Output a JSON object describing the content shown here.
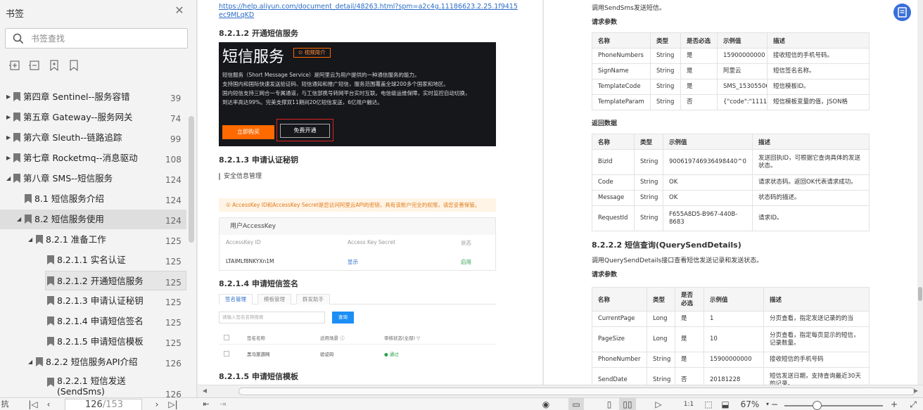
{
  "sidebar": {
    "title": "书签",
    "search_placeholder": "书签查找",
    "bookmarks": [
      {
        "label": "第四章 Sentinel--服务容错",
        "page": "39"
      },
      {
        "label": "第五章 Gateway--服务网关",
        "page": "74"
      },
      {
        "label": "第六章 Sleuth--链路追踪",
        "page": "99"
      },
      {
        "label": "第七章 Rocketmq--消息驱动",
        "page": "108"
      },
      {
        "label": "第八章 SMS--短信服务",
        "page": "124"
      },
      {
        "label": "8.1 短信服务介绍",
        "page": "124"
      },
      {
        "label": "8.2 短信服务使用",
        "page": "124"
      },
      {
        "label": "8.2.1 准备工作",
        "page": "125"
      },
      {
        "label": "8.2.1.1 实名认证",
        "page": "125"
      },
      {
        "label": "8.2.1.2 开通短信服务",
        "page": "125"
      },
      {
        "label": "8.2.1.3 申请认证秘钥",
        "page": "125"
      },
      {
        "label": "8.2.1.4 申请短信签名",
        "page": "125"
      },
      {
        "label": "8.2.1.5 申请短信模板",
        "page": "125"
      },
      {
        "label": "8.2.2 短信服务API介绍",
        "page": "126"
      },
      {
        "label": "8.2.2.1 短信发送(SendSms)",
        "page": "126"
      }
    ]
  },
  "left_page": {
    "link": "https://help.aliyun.com/document_detail/48263.html?spm=a2c4g.11186623.2.25.1f9415ec9MLqKD",
    "h_open": "8.2.1.2 开通短信服务",
    "banner": {
      "title": "短信服务",
      "badge": "⊙ 视频简介",
      "desc": [
        "短信服务（Short Message Service）是阿里云为用户提供的一种通信服务的能力。",
        "支持国内和国际快速发送验证码、短信通知和推广短信，服务范围覆盖全球200多个国家和地区。",
        "国内短信支持三网合一专属通道，与工信部携号转网平台实时互联。电信级运维保障，实时监控自动切换，",
        "到达率高达99%。完美支撑双11期间20亿短信发送，6亿用户触达。"
      ],
      "buy": "立即购买",
      "free": "免费开通"
    },
    "h_key": "8.2.1.3 申请认证秘钥",
    "note": "安全信息管理",
    "warning": "① AccessKey ID和AccessKey Secret是您访问阿里云API的密钥，具有该账户完全的权限，请您妥善保管。",
    "ak": {
      "title": "用户AccessKey",
      "h_id": "AccessKey ID",
      "h_secret": "Access Key Secret",
      "h_status": "状态",
      "id": "LTAIMLf8NKYXn1M",
      "secret": "显示",
      "status": "启用"
    },
    "h_sign": "8.2.1.4 申请短信签名",
    "sign_tabs": [
      "签名管理",
      "模板管理",
      "群发助手"
    ],
    "sign_input": "请输入签名名称搜索",
    "sign_btn": "查询",
    "sign_head": [
      "签名名称",
      "适用场景 ⓘ",
      "审核状态(全部) ▽"
    ],
    "sign_row": [
      "黑马旅游网",
      "验证码",
      "● 通过"
    ],
    "h_tpl": "8.2.1.5 申请短信模板"
  },
  "right_page": {
    "intro": "调用SendSms发送短信。",
    "req_label": "请求参数",
    "req_head": [
      "名称",
      "类型",
      "是否必选",
      "示例值",
      "描述"
    ],
    "req_rows": [
      [
        "PhoneNumbers",
        "String",
        "是",
        "15900000000",
        "接收短信的手机号码。"
      ],
      [
        "SignName",
        "String",
        "是",
        "阿里云",
        "短信签名名称。"
      ],
      [
        "TemplateCode",
        "String",
        "是",
        "SMS_153055065",
        "短信模板ID。"
      ],
      [
        "TemplateParam",
        "String",
        "否",
        "{\"code\":\"1111\"}",
        "短信模板变量的值，JSON格"
      ]
    ],
    "resp_label": "返回数据",
    "resp_head": [
      "名称",
      "类型",
      "示例值",
      "描述"
    ],
    "resp_rows": [
      [
        "BizId",
        "String",
        "900619746936498440^0",
        "发送回执ID，可根据它查询具体的发送状态。"
      ],
      [
        "Code",
        "String",
        "OK",
        "请求状态码。返回OK代表请求成功。"
      ],
      [
        "Message",
        "String",
        "OK",
        "状态码的描述。"
      ],
      [
        "RequestId",
        "String",
        "F655A8D5-B967-440B-8683",
        "请求ID。"
      ]
    ],
    "h_query": "8.2.2.2 短信查询(QuerySendDetails)",
    "query_intro": "调用QuerySendDetails接口查看短信发送记录和发送状态。",
    "req2_label": "请求参数",
    "req2_head": [
      "名称",
      "类型",
      "是否必选",
      "示例值",
      "描述"
    ],
    "req2_rows": [
      [
        "CurrentPage",
        "Long",
        "是",
        "1",
        "分页查看，指定发送记录的的当"
      ],
      [
        "PageSize",
        "Long",
        "是",
        "10",
        "分页查看，指定每页显示的短信，记录数量。"
      ],
      [
        "PhoneNumber",
        "String",
        "是",
        "15900000000",
        "接收短信的手机号码"
      ],
      [
        "SendDate",
        "String",
        "否",
        "20181228",
        "短信发送日期，支持查询最近30天的记录。"
      ]
    ]
  },
  "bottombar": {
    "current_page": "126",
    "total_pages": "/153",
    "zoom": "67%",
    "left_cut": "抗"
  }
}
